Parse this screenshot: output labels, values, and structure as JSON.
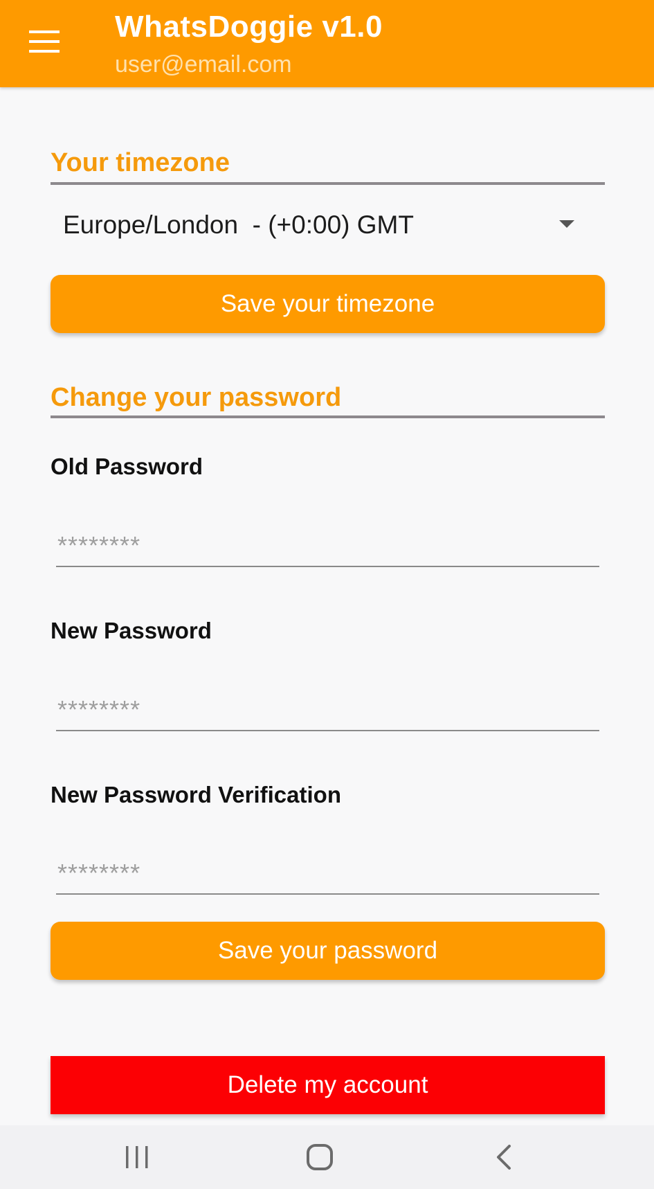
{
  "header": {
    "title": "WhatsDoggie v1.0",
    "subtitle": "user@email.com",
    "menu_icon": "hamburger-menu-icon",
    "background_color": "#fe9a00"
  },
  "timezone_section": {
    "title": "Your timezone",
    "selected_value": "Europe/London  - (+0:00) GMT",
    "save_label": "Save your timezone"
  },
  "password_section": {
    "title": "Change your password",
    "fields": [
      {
        "label": "Old Password",
        "placeholder": "********"
      },
      {
        "label": "New Password",
        "placeholder": "********"
      },
      {
        "label": "New Password Verification",
        "placeholder": "********"
      }
    ],
    "save_label": "Save your password"
  },
  "danger": {
    "delete_label": "Delete my account",
    "color": "#fc0004"
  },
  "nav_bar": {
    "buttons": [
      "recent-apps-icon",
      "home-icon",
      "back-icon"
    ]
  },
  "colors": {
    "accent": "#fe9a00",
    "section_title": "#f59a0c",
    "danger": "#fc0004"
  }
}
